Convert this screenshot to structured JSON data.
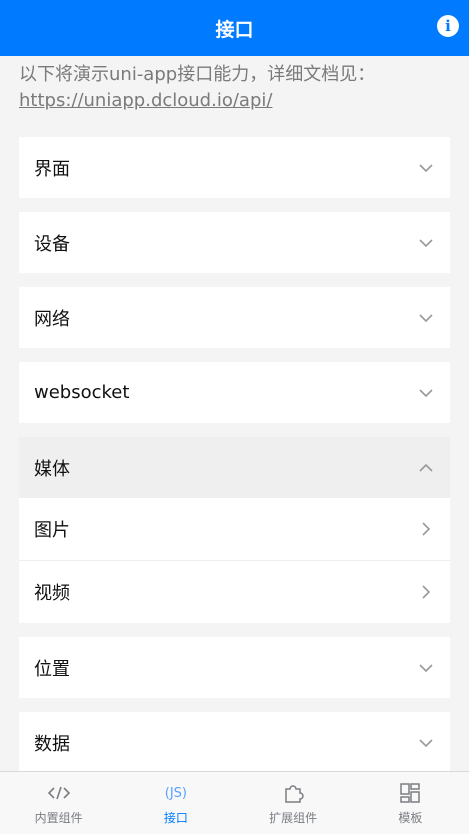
{
  "header": {
    "title": "接口",
    "info_icon": "info-icon"
  },
  "intro": {
    "text": "以下将演示uni-app接口能力，详细文档见：",
    "link": "https://uniapp.dcloud.io/api/"
  },
  "groups": [
    {
      "label": "界面",
      "open": false
    },
    {
      "label": "设备",
      "open": false
    },
    {
      "label": "网络",
      "open": false
    },
    {
      "label": "websocket",
      "open": false
    },
    {
      "label": "媒体",
      "open": true,
      "items": [
        {
          "label": "图片"
        },
        {
          "label": "视频"
        }
      ]
    },
    {
      "label": "位置",
      "open": false
    },
    {
      "label": "数据",
      "open": false
    }
  ],
  "tabbar": {
    "active_color": "#007aff",
    "tabs": [
      {
        "label": "内置组件",
        "icon": "code-icon"
      },
      {
        "label": "接口",
        "icon": "js-icon",
        "icon_text": "(JS)",
        "active": true
      },
      {
        "label": "扩展组件",
        "icon": "puzzle-icon"
      },
      {
        "label": "模板",
        "icon": "template-icon"
      }
    ]
  }
}
